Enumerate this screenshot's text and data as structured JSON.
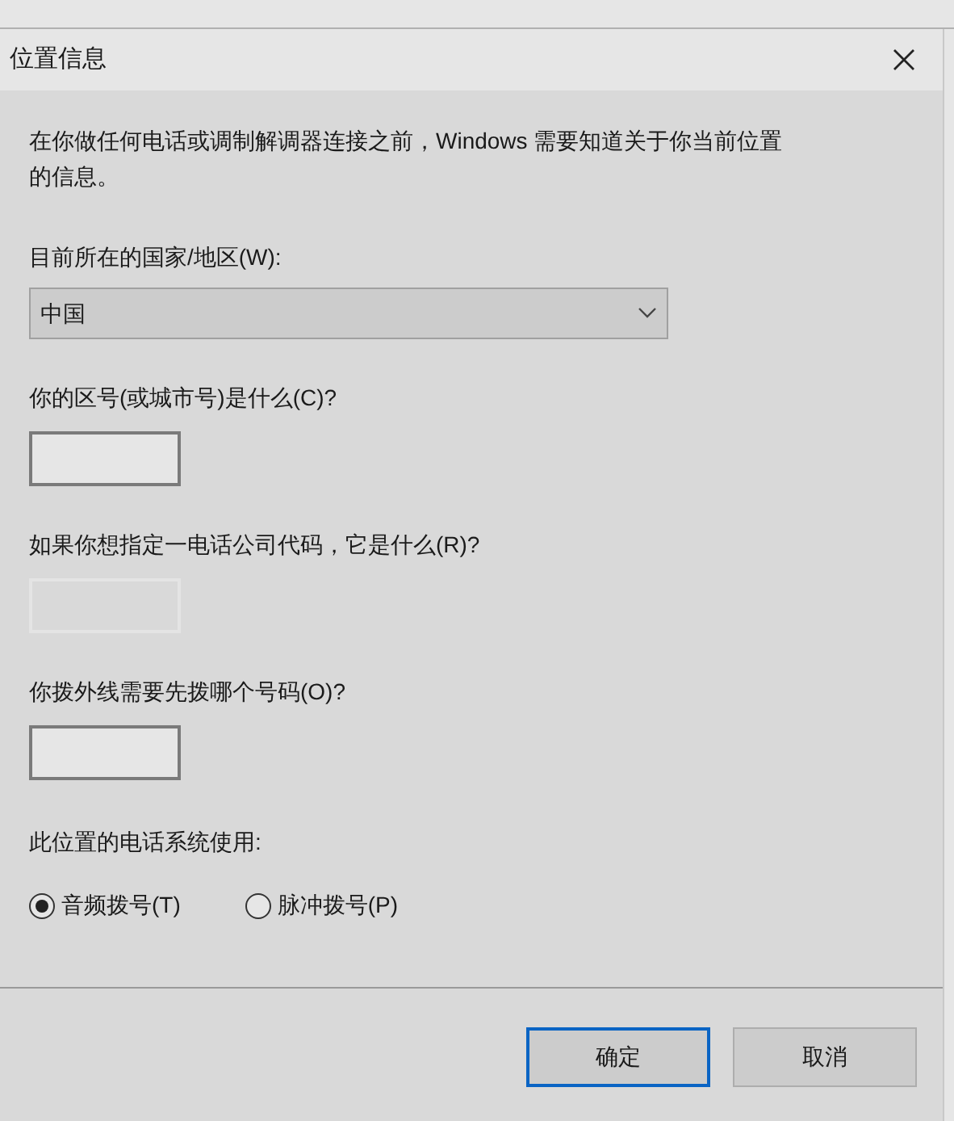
{
  "window": {
    "title": "位置信息"
  },
  "description": "在你做任何电话或调制解调器连接之前，Windows 需要知道关于你当前位置的信息。",
  "country": {
    "label": "目前所在的国家/地区(W):",
    "value": "中国"
  },
  "fields": [
    {
      "label": "你的区号(或城市号)是什么(C)?",
      "disabled": false
    },
    {
      "label": "如果你想指定一电话公司代码，它是什么(R)?",
      "disabled": true
    },
    {
      "label": "你拨外线需要先拨哪个号码(O)?",
      "disabled": false
    }
  ],
  "dialing": {
    "label": "此位置的电话系统使用:",
    "options": [
      {
        "label": "音频拨号(T)",
        "selected": true
      },
      {
        "label": "脉冲拨号(P)",
        "selected": false
      }
    ]
  },
  "buttons": [
    {
      "label": "确定",
      "default": true
    },
    {
      "label": "取消",
      "default": false
    }
  ]
}
